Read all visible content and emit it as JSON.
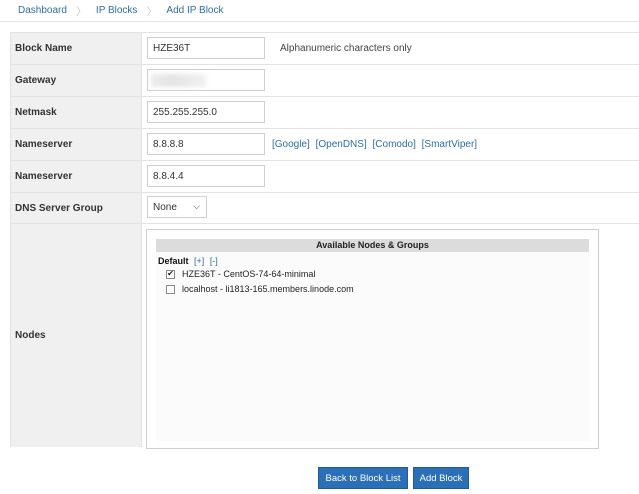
{
  "breadcrumb": {
    "items": [
      "Dashboard",
      "IP Blocks",
      "Add IP Block"
    ]
  },
  "form": {
    "block_name": {
      "label": "Block Name",
      "value": "HZE36T",
      "hint": "Alphanumeric characters only"
    },
    "gateway": {
      "label": "Gateway"
    },
    "netmask": {
      "label": "Netmask",
      "value": "255.255.255.0"
    },
    "nameserver1": {
      "label": "Nameserver",
      "value": "8.8.8.8",
      "links": [
        "[Google]",
        "[OpenDNS]",
        "[Comodo]",
        "[SmartViper]"
      ]
    },
    "nameserver2": {
      "label": "Nameserver",
      "value": "8.8.4.4"
    },
    "dns_group": {
      "label": "DNS Server Group",
      "selected": "None"
    },
    "nodes": {
      "label": "Nodes",
      "header": "Available Nodes & Groups",
      "group_name": "Default",
      "expand": "[+]",
      "collapse": "[-]",
      "items": [
        {
          "label": "HZE36T - CentOS-74-64-minimal",
          "checked": true
        },
        {
          "label": "localhost - li1813-165.members.linode.com",
          "checked": false
        }
      ]
    }
  },
  "actions": {
    "back_label": "Back to Block List",
    "add_label": "Add Block"
  },
  "colors": {
    "link": "#2e6da4",
    "button": "#2b6fb6",
    "label_bg": "#f0f0f0"
  }
}
